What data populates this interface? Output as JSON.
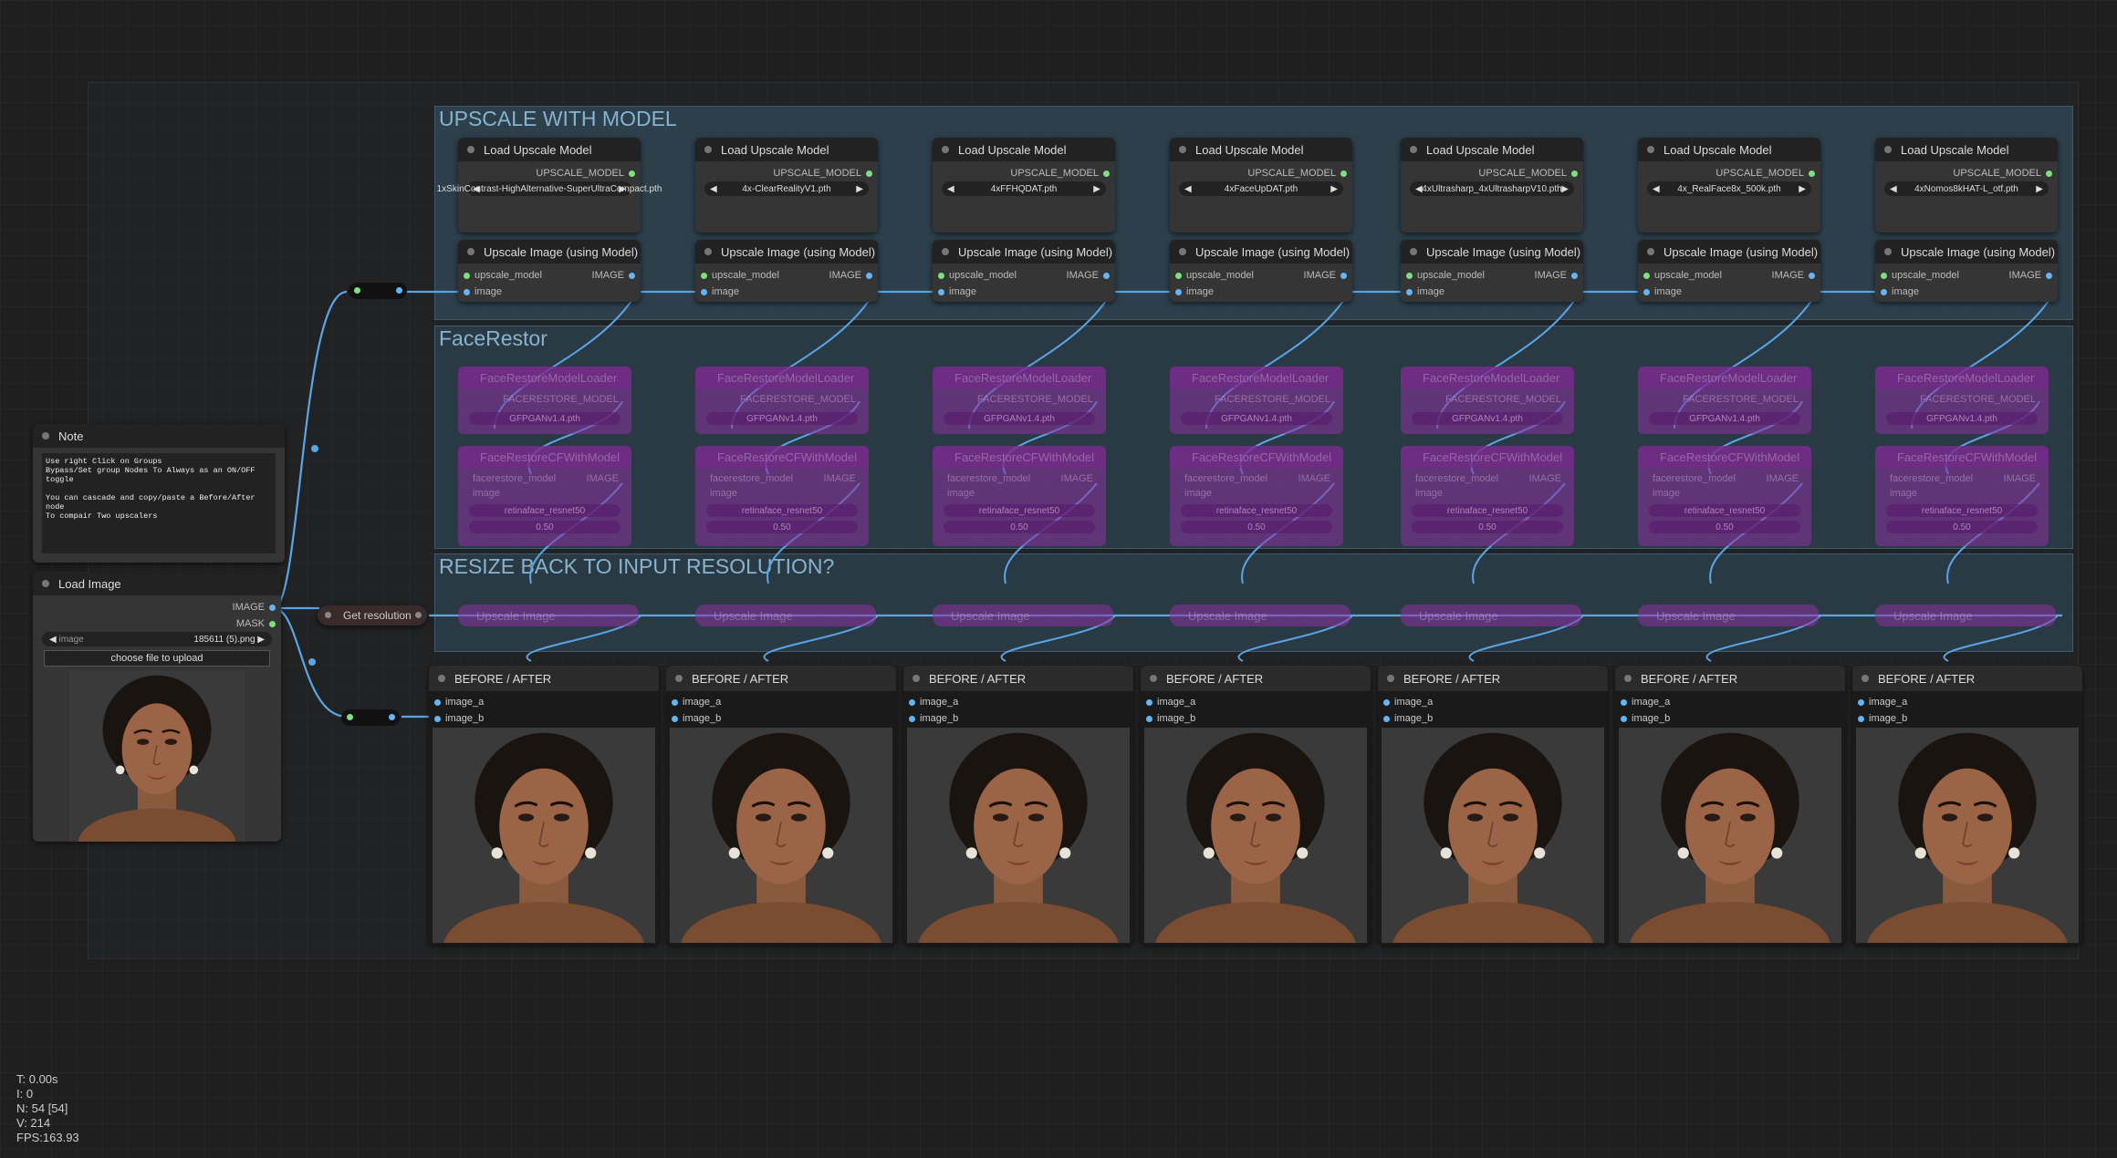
{
  "groups": {
    "upscale": "UPSCALE WITH MODEL",
    "face": "FaceRestor",
    "resize": "RESIZE BACK TO INPUT RESOLUTION?"
  },
  "load_upscale": {
    "title": "Load Upscale Model",
    "output": "UPSCALE_MODEL",
    "models": [
      "1xSkinContrast-HighAlternative-SuperUltraCompact.pth",
      "4x-ClearRealityV1.pth",
      "4xFFHQDAT.pth",
      "4xFaceUpDAT.pth",
      "4xUltrasharp_4xUltrasharpV10.pth",
      "4x_RealFace8x_500k.pth",
      "4xNomos8kHAT-L_otf.pth"
    ]
  },
  "upscale_image": {
    "title": "Upscale Image (using Model)",
    "in_model": "upscale_model",
    "in_image": "image",
    "output": "IMAGE"
  },
  "face_loader": {
    "title": "FaceRestoreModelLoader",
    "output": "FACERESTORE_MODEL",
    "model": "GFPGANv1.4.pth"
  },
  "face_cf": {
    "title": "FaceRestoreCFWithModel",
    "in_model": "facerestore_model",
    "in_image": "image",
    "output": "IMAGE",
    "detection": "retinaface_resnet50",
    "codeformer": "0.50"
  },
  "resize_node": "Upscale Image",
  "get_resolution": "Get resolution",
  "note": {
    "title": "Note",
    "text": "Use right Click on Groups\nBypass/Set group Nodes To Always as an ON/OFF toggle\n\nYou can cascade and copy/paste a Before/After node\nTo compair Two upscalers"
  },
  "load_image": {
    "title": "Load Image",
    "out_image": "IMAGE",
    "out_mask": "MASK",
    "widget_label": "image",
    "widget_value": "185611 (5).png",
    "upload": "choose file to upload"
  },
  "before_after": {
    "title": "BEFORE / AFTER",
    "in_a": "image_a",
    "in_b": "image_b"
  },
  "stats": [
    "T: 0.00s",
    "I: 0",
    "N: 54 [54]",
    "V: 214",
    "FPS:163.93"
  ],
  "colors": {
    "canvas": "#1f1f1f",
    "group": "#3d5a6e",
    "link": "#64b5f6",
    "bypass": "#8c32a0"
  }
}
